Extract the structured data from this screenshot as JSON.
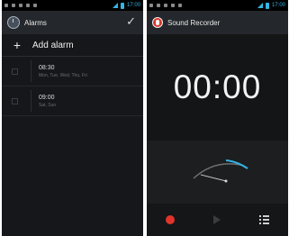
{
  "alarms_screen": {
    "title": "Alarms",
    "add_label": "Add alarm",
    "alarms": [
      {
        "time": "08:30",
        "days": "Mon, Tue, Wed, Thu, Fri"
      },
      {
        "time": "09:00",
        "days": "Sat, Sun"
      }
    ]
  },
  "recorder_screen": {
    "title": "Sound Recorder",
    "timer": "00:00"
  },
  "status_bar": {
    "left_time": "17:00",
    "right_time": "17:00"
  },
  "colors": {
    "accent": "#33b5e5",
    "record": "#e0342b",
    "actionbar": "#24272b"
  },
  "icons": [
    "clock-icon",
    "check-icon",
    "plus-icon",
    "microphone-icon",
    "record-icon",
    "play-icon",
    "list-icon",
    "vu-meter"
  ]
}
